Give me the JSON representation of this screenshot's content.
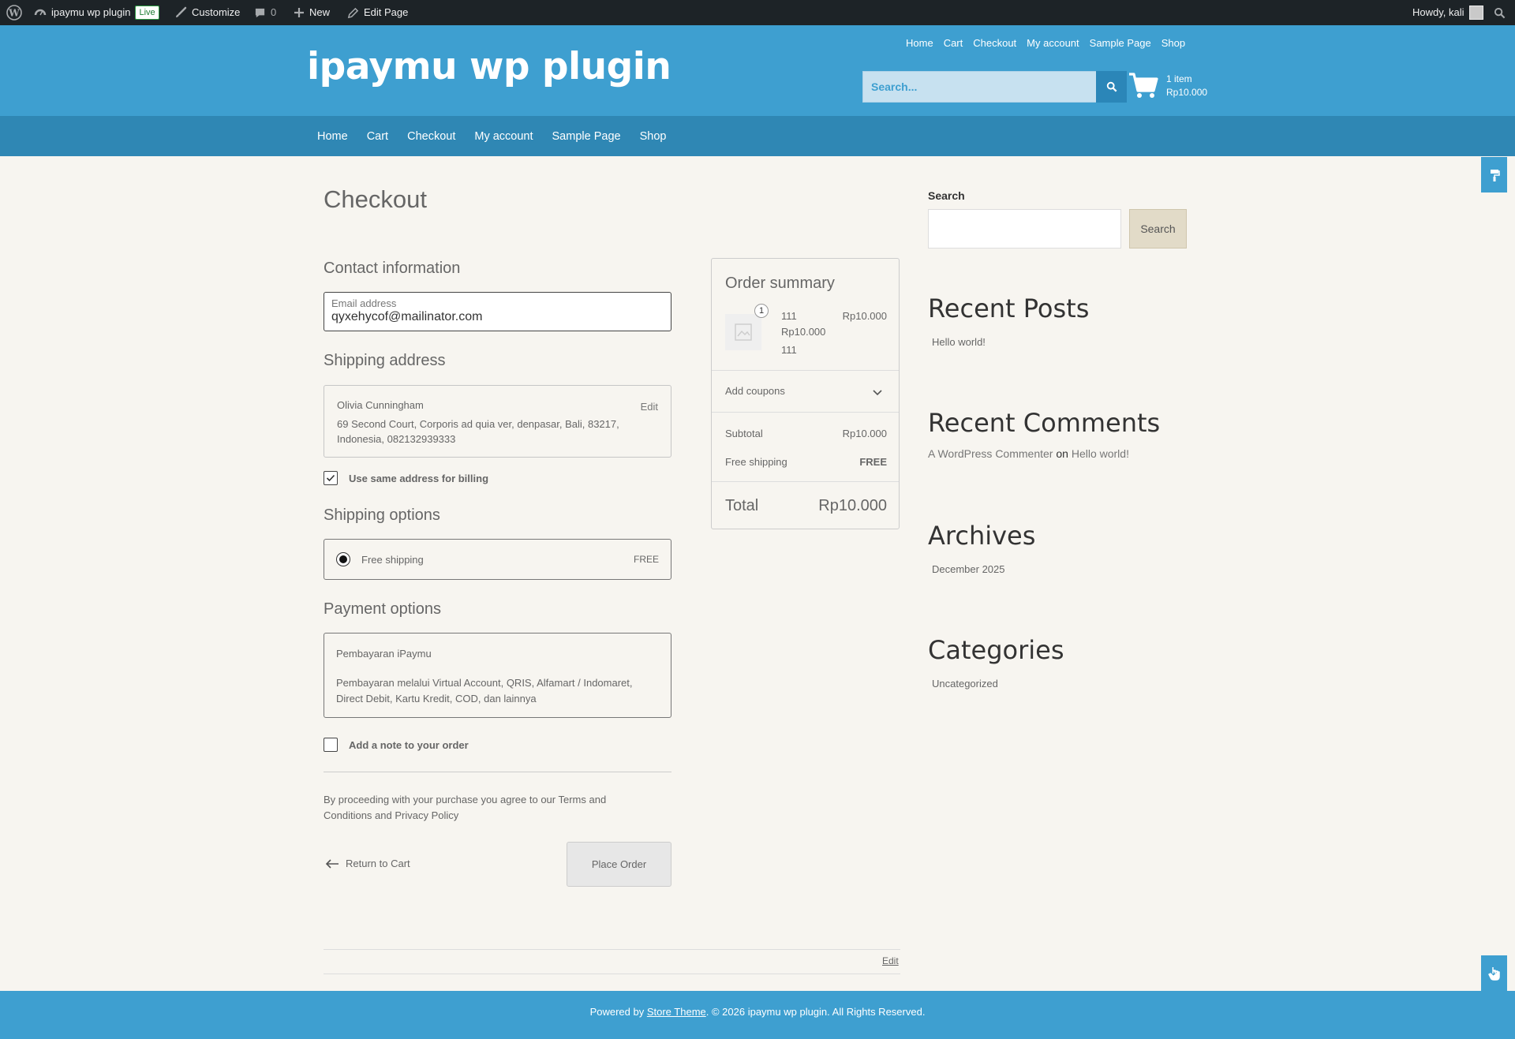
{
  "admin_bar": {
    "site_name": "ipaymu wp plugin",
    "live_badge": "Live",
    "customize": "Customize",
    "comments_count": "0",
    "new": "New",
    "edit_page": "Edit Page",
    "howdy": "Howdy, kali"
  },
  "header": {
    "site_title": "ipaymu wp plugin",
    "top_nav": [
      "Home",
      "Cart",
      "Checkout",
      "My account",
      "Sample Page",
      "Shop"
    ],
    "search_placeholder": "Search...",
    "cart_items": "1 item",
    "cart_total": "Rp10.000"
  },
  "primary_nav": [
    "Home",
    "Cart",
    "Checkout",
    "My account",
    "Sample Page",
    "Shop"
  ],
  "checkout": {
    "title": "Checkout",
    "contact_heading": "Contact information",
    "email_label": "Email address",
    "email_value": "qyxehycof@mailinator.com",
    "shipping_heading": "Shipping address",
    "shipping_name": "Olivia Cunningham",
    "shipping_address": "69 Second Court, Corporis ad quia ver, denpasar, Bali, 83217, Indonesia, 082132939333",
    "edit_label": "Edit",
    "same_billing_label": "Use same address for billing",
    "shipping_options_heading": "Shipping options",
    "shipping_option_label": "Free shipping",
    "shipping_option_price": "FREE",
    "payment_heading": "Payment options",
    "payment_title": "Pembayaran iPaymu",
    "payment_desc": "Pembayaran melalui Virtual Account, QRIS, Alfamart / Indomaret, Direct Debit, Kartu Kredit, COD, dan lainnya",
    "note_label": "Add a note to your order",
    "terms": "By proceeding with your purchase you agree to our Terms and Conditions and Privacy Policy",
    "return_to_cart": "Return to Cart",
    "place_order": "Place Order",
    "page_edit": "Edit"
  },
  "order_summary": {
    "heading": "Order summary",
    "item_qty": "1",
    "item_name": "111",
    "item_price": "Rp10.000",
    "item_desc": "111",
    "item_total": "Rp10.000",
    "add_coupons": "Add coupons",
    "subtotal_label": "Subtotal",
    "subtotal_value": "Rp10.000",
    "shipping_label": "Free shipping",
    "shipping_value": "FREE",
    "total_label": "Total",
    "total_value": "Rp10.000"
  },
  "sidebar": {
    "search_label": "Search",
    "search_button": "Search",
    "recent_posts_heading": "Recent Posts",
    "recent_post": "Hello world!",
    "recent_comments_heading": "Recent Comments",
    "comment_author": "A WordPress Commenter",
    "comment_on": "on",
    "comment_post": "Hello world!",
    "archives_heading": "Archives",
    "archive_item": "December 2025",
    "categories_heading": "Categories",
    "category_item": "Uncategorized"
  },
  "footer": {
    "powered_by": "Powered by",
    "theme_link": "Store Theme",
    "copyright": ". © 2026 ipaymu wp plugin. All Rights Reserved."
  },
  "colors": {
    "header_blue": "#3e9fd0",
    "nav_blue": "#2f87b4",
    "admin_bar": "#1d2327",
    "page_bg": "#f7f5f0"
  },
  "icons": [
    "wordpress-logo-icon",
    "dashboard-icon",
    "brush-icon",
    "comment-icon",
    "plus-icon",
    "pencil-icon",
    "search-icon",
    "cart-icon",
    "image-placeholder-icon",
    "chevron-down-icon",
    "arrow-left-icon",
    "checkmark-icon",
    "paint-roller-icon",
    "hand-pointer-icon"
  ]
}
